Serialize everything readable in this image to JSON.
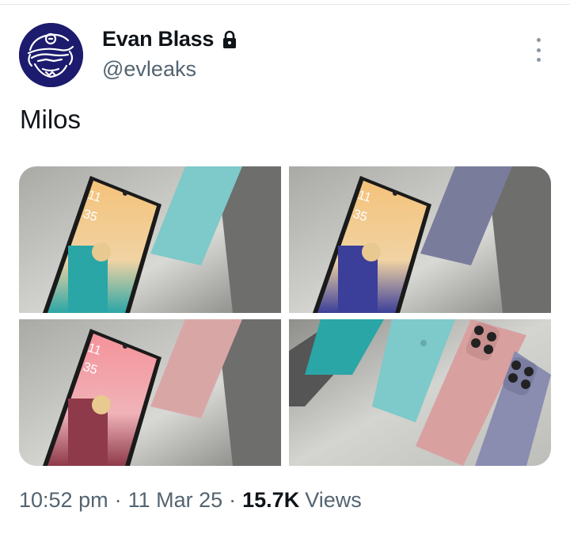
{
  "author": {
    "display_name": "Evan Blass",
    "handle": "@evleaks",
    "protected_icon": "lock-icon",
    "avatar_colors": {
      "background": "#1c1b6e",
      "line": "#ffffff"
    }
  },
  "tweet": {
    "text": "Milos",
    "media": [
      {
        "screen_hour": "11",
        "screen_minute": "35",
        "phone_color": "#7ec9c9",
        "screen_top": "#f4c27a",
        "screen_bottom": "#2aa6a6"
      },
      {
        "screen_hour": "11",
        "screen_minute": "35",
        "phone_color": "#7a7c9c",
        "screen_top": "#f4c27a",
        "screen_bottom": "#3b3f9a"
      },
      {
        "screen_hour": "11",
        "screen_minute": "35",
        "phone_color": "#d9a6a6",
        "screen_top": "#f5929a",
        "screen_bottom": "#8e3a4a"
      },
      {
        "phone_colors": [
          "#7ec9c9",
          "#d9a0a0",
          "#8a8cb0"
        ]
      }
    ]
  },
  "meta": {
    "time": "10:52 pm",
    "separator": "·",
    "date": "11 Mar 25",
    "views_count": "15.7K",
    "views_label": "Views"
  },
  "icons": {
    "more": "more-vertical-icon"
  }
}
